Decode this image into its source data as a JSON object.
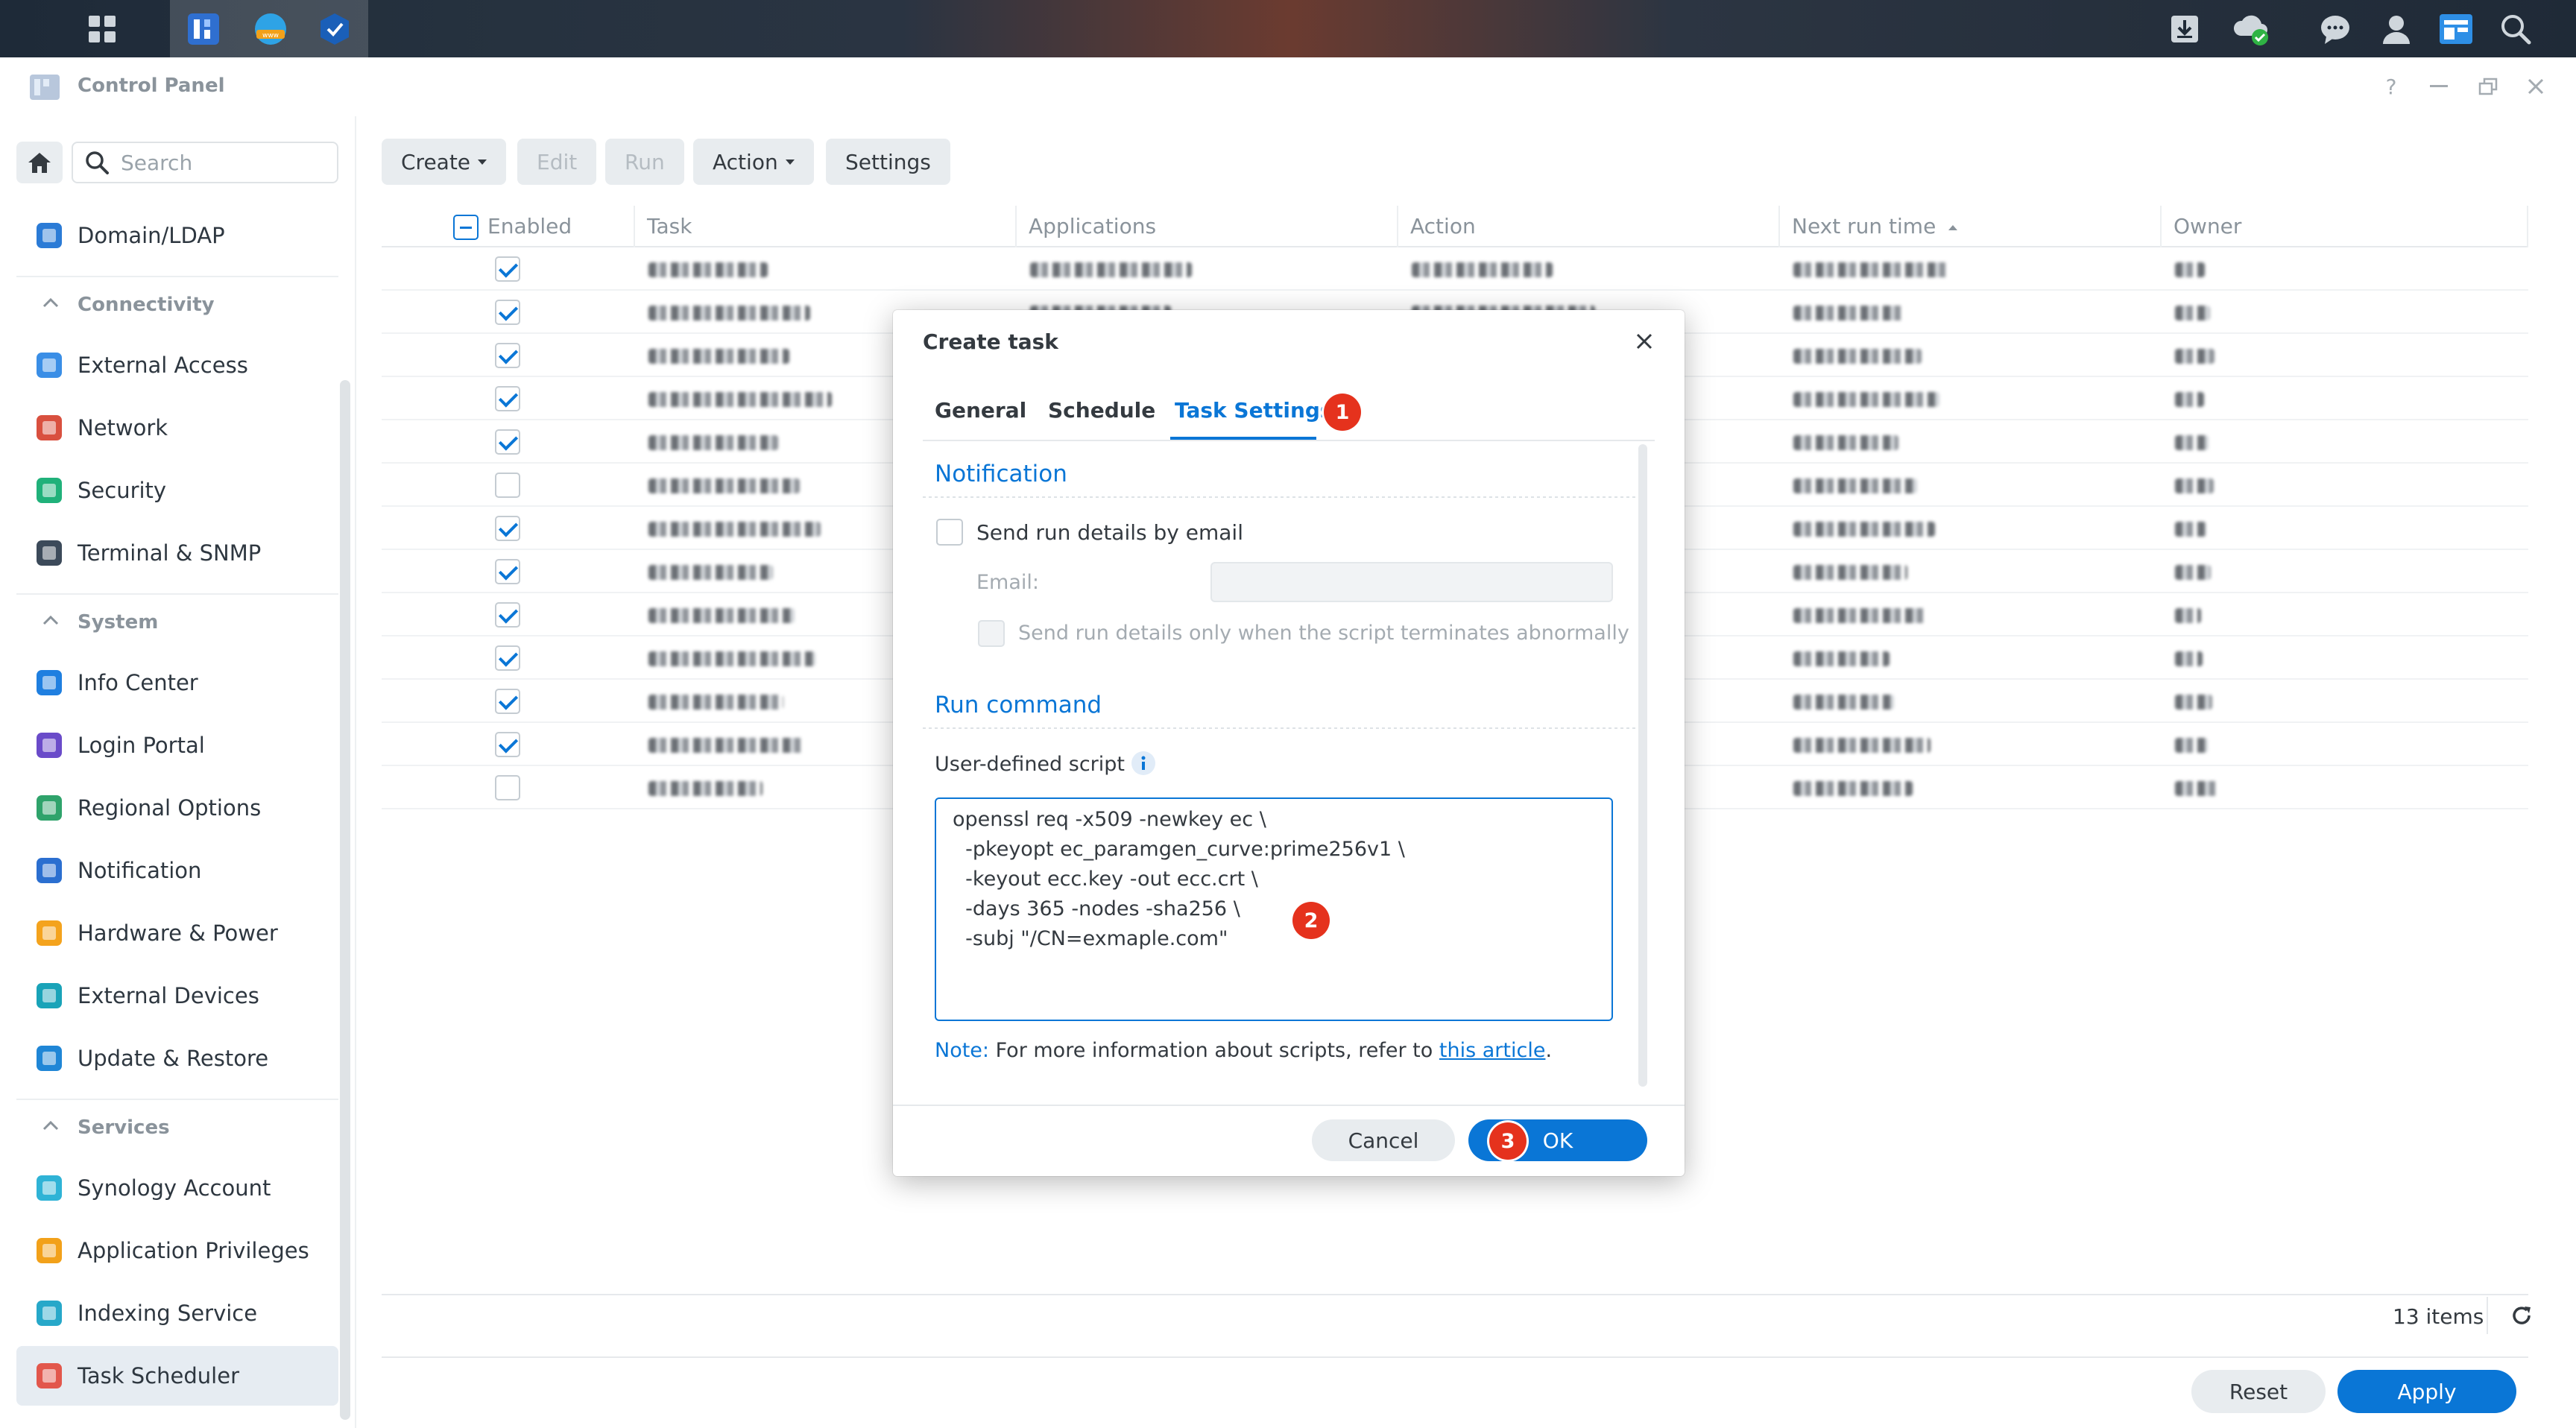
{
  "window": {
    "title": "Control Panel"
  },
  "search": {
    "placeholder": "Search"
  },
  "sidebar": {
    "items_top": [
      {
        "label": "Domain/LDAP",
        "icon": "domain-ldap-icon"
      }
    ],
    "sections": [
      {
        "title": "Connectivity",
        "items": [
          {
            "label": "External Access",
            "icon": "external-access-icon"
          },
          {
            "label": "Network",
            "icon": "network-icon"
          },
          {
            "label": "Security",
            "icon": "security-icon"
          },
          {
            "label": "Terminal & SNMP",
            "icon": "terminal-icon"
          }
        ]
      },
      {
        "title": "System",
        "items": [
          {
            "label": "Info Center",
            "icon": "info-center-icon"
          },
          {
            "label": "Login Portal",
            "icon": "login-portal-icon"
          },
          {
            "label": "Regional Options",
            "icon": "regional-options-icon"
          },
          {
            "label": "Notification",
            "icon": "notification-icon"
          },
          {
            "label": "Hardware & Power",
            "icon": "hardware-power-icon"
          },
          {
            "label": "External Devices",
            "icon": "external-devices-icon"
          },
          {
            "label": "Update & Restore",
            "icon": "update-restore-icon"
          }
        ]
      },
      {
        "title": "Services",
        "items": [
          {
            "label": "Synology Account",
            "icon": "synology-account-icon"
          },
          {
            "label": "Application Privileges",
            "icon": "application-privileges-icon"
          },
          {
            "label": "Indexing Service",
            "icon": "indexing-service-icon"
          },
          {
            "label": "Task Scheduler",
            "icon": "task-scheduler-icon",
            "selected": true
          }
        ]
      }
    ]
  },
  "toolbar": {
    "create": "Create",
    "edit": "Edit",
    "run": "Run",
    "action": "Action",
    "settings": "Settings"
  },
  "table": {
    "columns": [
      "Enabled",
      "Task",
      "Applications",
      "Action",
      "Next run time",
      "Owner"
    ],
    "enabled": [
      true,
      true,
      true,
      true,
      true,
      false,
      true,
      true,
      true,
      true,
      true,
      true,
      false
    ]
  },
  "footer": {
    "items_count": "13 items",
    "reset": "Reset",
    "apply": "Apply"
  },
  "dialog": {
    "title": "Create task",
    "tabs": [
      "General",
      "Schedule",
      "Task Settings"
    ],
    "active_tab": "Task Settings",
    "notification_title": "Notification",
    "send_email_label": "Send run details by email",
    "email_label": "Email:",
    "email_value": "",
    "abnormal_label": "Send run details only when the script terminates abnormally",
    "run_command_title": "Run command",
    "script_label": "User-defined script",
    "script": "openssl req -x509 -newkey ec \\\n  -pkeyopt ec_paramgen_curve:prime256v1 \\\n  -keyout ecc.key -out ecc.crt \\\n  -days 365 -nodes -sha256 \\\n  -subj \"/CN=exmaple.com\"",
    "note_label": "Note:",
    "note_text": "For more information about scripts, refer to",
    "note_link": "this article",
    "note_end": ".",
    "cancel": "Cancel",
    "ok": "OK"
  },
  "badges": [
    "1",
    "2",
    "3"
  ],
  "colors": {
    "accent": "#0a76d6",
    "badge": "#e5321d"
  }
}
